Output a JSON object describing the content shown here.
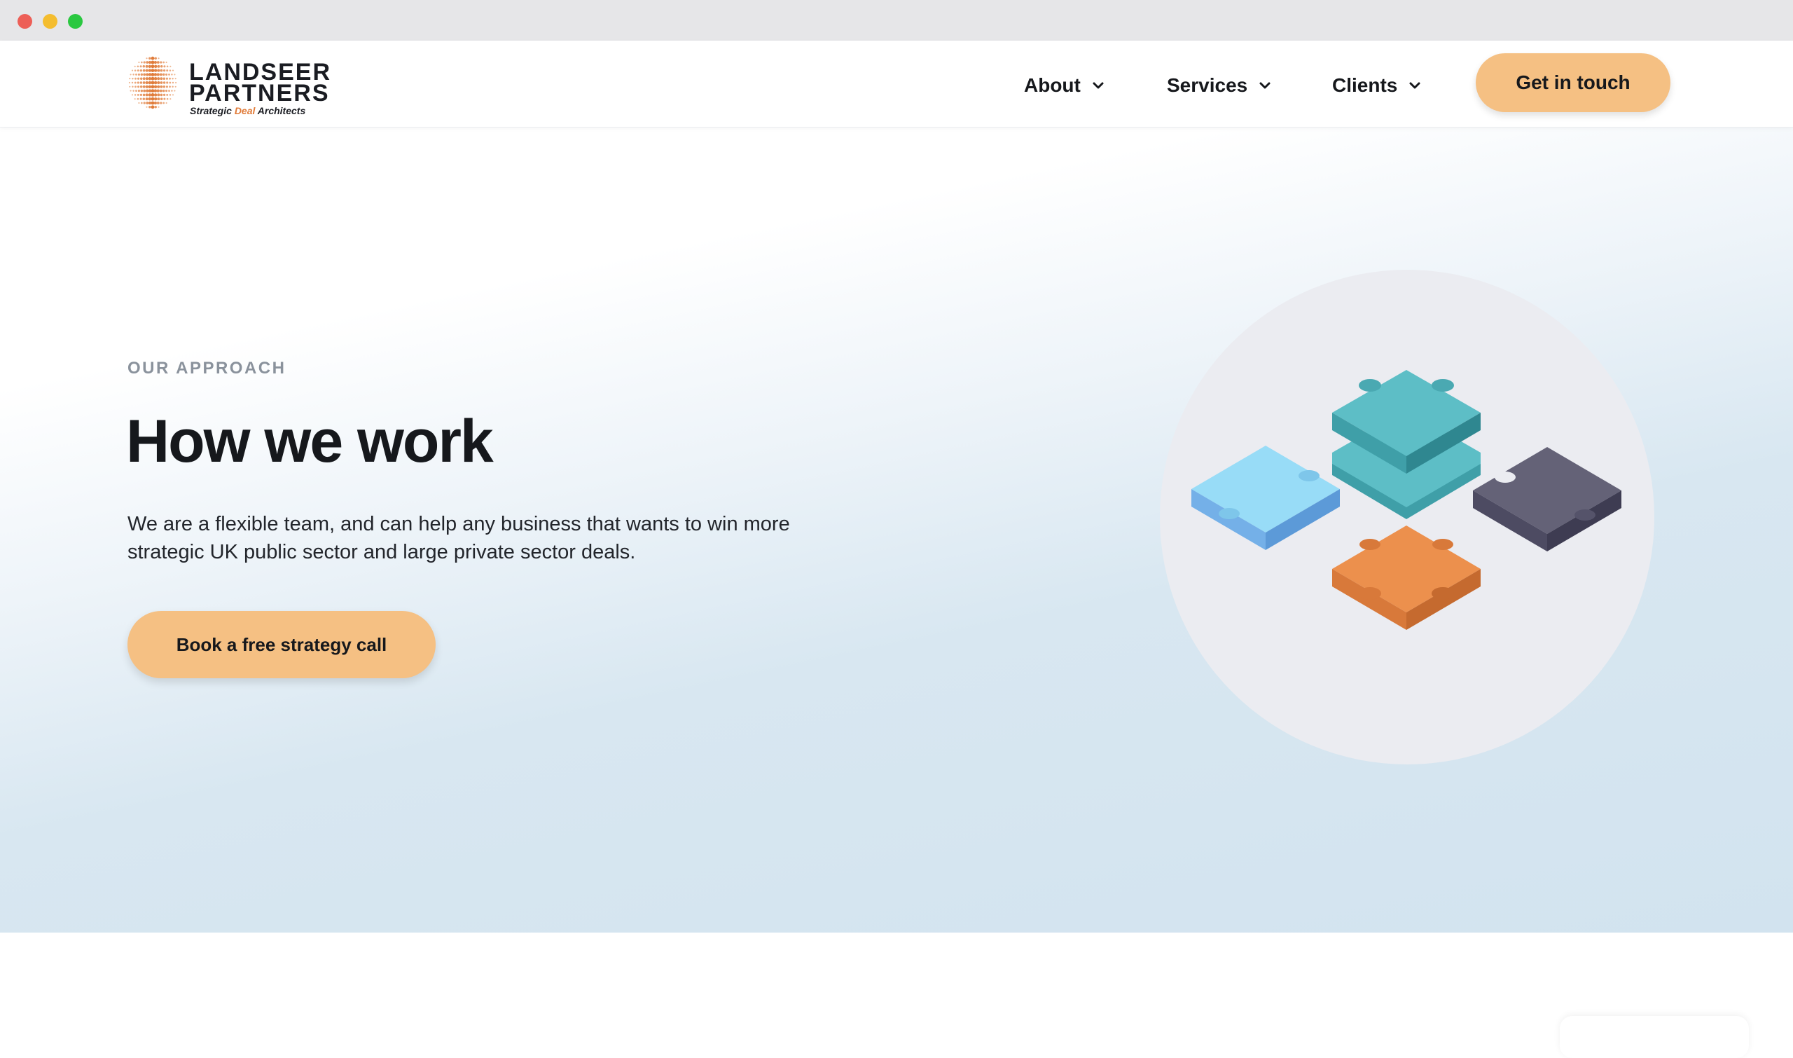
{
  "nav": {
    "logo": {
      "word1": "LANDSEER",
      "word2": "PARTNERS",
      "tag_before": "Strategic",
      "tag_accent": "Deal",
      "tag_after": "Architects"
    },
    "items": [
      {
        "label": "About",
        "icon": "chevron-down-icon"
      },
      {
        "label": "Services",
        "icon": "chevron-down-icon"
      },
      {
        "label": "Clients",
        "icon": "chevron-down-icon"
      }
    ],
    "cta": "Get in touch"
  },
  "hero": {
    "eyebrow": "OUR APPROACH",
    "title": "How we work",
    "description": "We are a flexible team, and can help any business that wants to win more strategic UK public sector and large private sector deals.",
    "cta": "Book a free strategy call",
    "illustration": "puzzle-pieces"
  },
  "colors": {
    "accent_button": "#f5c083",
    "text_dark": "#16181c",
    "eyebrow": "#8a929c",
    "hero_bg": "#d2e3ef",
    "puzzle_teal": "#5dbec6",
    "puzzle_lightblue": "#98dcf7",
    "puzzle_slate": "#646277",
    "puzzle_orange": "#ec904d",
    "logo_orange": "#e07b39"
  }
}
